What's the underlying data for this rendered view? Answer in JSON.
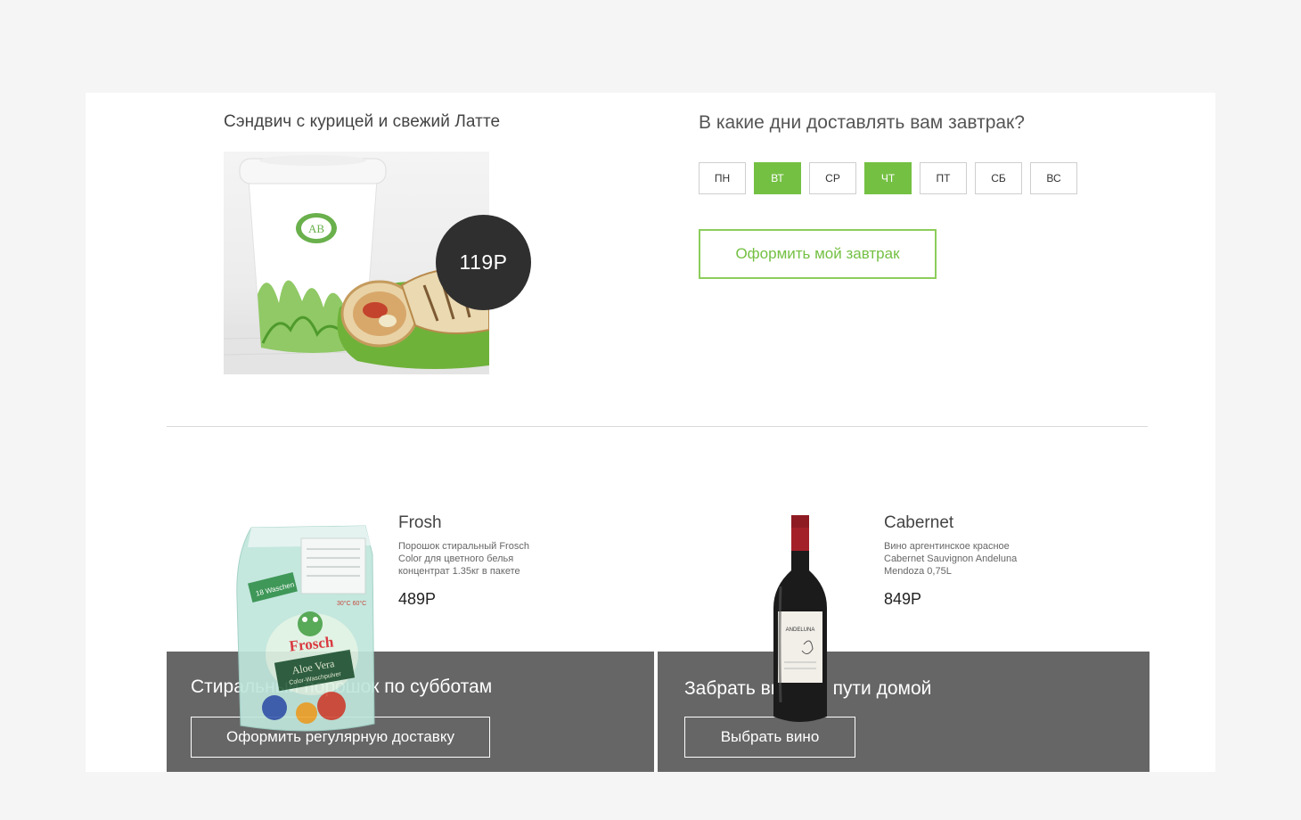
{
  "breakfast": {
    "title": "Сэндвич с курицей и свежий Латте",
    "price": "119Р",
    "cup_logo": "АВ"
  },
  "delivery": {
    "question": "В какие дни доставлять вам завтрак?",
    "days": [
      {
        "label": "ПН",
        "selected": false
      },
      {
        "label": "ВТ",
        "selected": true
      },
      {
        "label": "СР",
        "selected": false
      },
      {
        "label": "ЧТ",
        "selected": true
      },
      {
        "label": "ПТ",
        "selected": false
      },
      {
        "label": "СБ",
        "selected": false
      },
      {
        "label": "ВС",
        "selected": false
      }
    ],
    "order_label": "Оформить мой завтрак"
  },
  "products": [
    {
      "name": "Frosh",
      "description": [
        "Порошок стиральный Frosch",
        "Color для цветного белья",
        "концентрат 1.35кг в пакете"
      ],
      "price": "489Р",
      "package_brand": "Frosch",
      "package_variant": "Aloe Vera",
      "package_sub": "Color-Waschpulver",
      "package_badge": "18 Waschen",
      "package_temp": "30°C 60°C",
      "promo_title": "Стиральный порошок по субботам",
      "promo_button": "Оформить регулярную доставку"
    },
    {
      "name": "Cabernet",
      "description": [
        "Вино аргентинское красное",
        "Cabernet Sauvignon Andeluna",
        "Mendoza 0,75L"
      ],
      "price": "849Р",
      "label_brand": "ANDELUNA",
      "promo_title": "Забрать вино по пути домой",
      "promo_button": "Выбрать вино"
    }
  ],
  "colors": {
    "accent": "#74c043",
    "promo_bg": "#666666",
    "price_bubble": "#2f2f2f",
    "page_bg": "#f5f5f5"
  }
}
